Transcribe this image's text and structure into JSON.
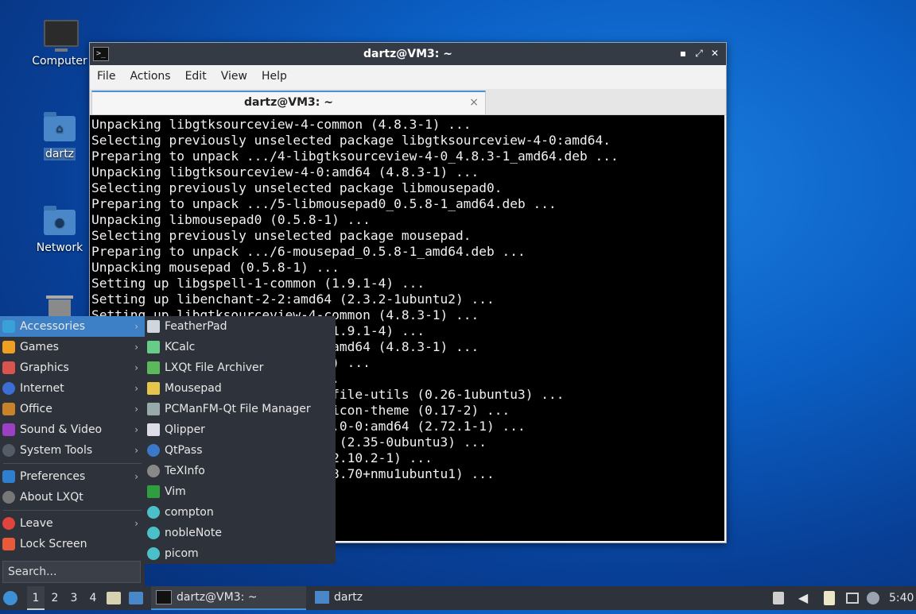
{
  "desktop": {
    "icons": [
      {
        "label": "Computer",
        "icon": "computer-icon"
      },
      {
        "label": "dartz",
        "icon": "home-folder-icon"
      },
      {
        "label": "Network",
        "icon": "network-folder-icon"
      },
      {
        "label": "",
        "icon": "trash-icon"
      }
    ]
  },
  "terminal": {
    "title": "dartz@VM3: ~",
    "menu": [
      "File",
      "Actions",
      "Edit",
      "View",
      "Help"
    ],
    "tab_label": "dartz@VM3: ~",
    "close_glyph": "×",
    "lines": [
      "Unpacking libgtksourceview-4-common (4.8.3-1) ...",
      "Selecting previously unselected package libgtksourceview-4-0:amd64.",
      "Preparing to unpack .../4-libgtksourceview-4-0_4.8.3-1_amd64.deb ...",
      "Unpacking libgtksourceview-4-0:amd64 (4.8.3-1) ...",
      "Selecting previously unselected package libmousepad0.",
      "Preparing to unpack .../5-libmousepad0_0.5.8-1_amd64.deb ...",
      "Unpacking libmousepad0 (0.5.8-1) ...",
      "Selecting previously unselected package mousepad.",
      "Preparing to unpack .../6-mousepad_0.5.8-1_amd64.deb ...",
      "Unpacking mousepad (0.5.8-1) ...",
      "Setting up libgspell-1-common (1.9.1-4) ...",
      "Setting up libenchant-2-2:amd64 (2.3.2-1ubuntu2) ...",
      "Setting up libgtksourceview-4-common (4.8.3-1) ...",
      "                              (1.9.1-4) ...",
      "                              :amd64 (4.8.3-1) ...",
      "                              1) ...",
      "                              ..",
      "                              -file-utils (0.26-1ubuntu3) ...",
      "                              -icon-theme (0.17-2) ...",
      "                              2.0-0:amd64 (2.72.1-1) ...",
      "                              n (2.35-0ubuntu3) ...",
      "                              (2.10.2-1) ...",
      "                              (3.70+nmu1ubuntu1) ..."
    ]
  },
  "start_menu": {
    "categories": [
      {
        "label": "Accessories",
        "icon": "accessories-icon",
        "color": "#3aa0d8"
      },
      {
        "label": "Games",
        "icon": "games-icon",
        "color": "#f0a020"
      },
      {
        "label": "Graphics",
        "icon": "graphics-icon",
        "color": "#d9534f"
      },
      {
        "label": "Internet",
        "icon": "internet-icon",
        "color": "#3b6fd6"
      },
      {
        "label": "Office",
        "icon": "office-icon",
        "color": "#c8832a"
      },
      {
        "label": "Sound & Video",
        "icon": "sound-video-icon",
        "color": "#9b3fc4"
      },
      {
        "label": "System Tools",
        "icon": "system-tools-icon",
        "color": "#555c66"
      },
      {
        "label": "Preferences",
        "icon": "preferences-icon",
        "color": "#2f7fd0"
      },
      {
        "label": "About LXQt",
        "icon": "info-icon",
        "color": "#777"
      },
      {
        "label": "Leave",
        "icon": "power-icon",
        "color": "#e0443c"
      },
      {
        "label": "Lock Screen",
        "icon": "lock-icon",
        "color": "#e85a3a"
      }
    ],
    "arrow": "›",
    "search_placeholder": "Search...",
    "accessories": [
      {
        "label": "FeatherPad",
        "icon": "featherpad-icon",
        "color": "#cfd6de"
      },
      {
        "label": "KCalc",
        "icon": "calculator-icon",
        "color": "#6c8"
      },
      {
        "label": "LXQt File Archiver",
        "icon": "archiver-icon",
        "color": "#5cb85c"
      },
      {
        "label": "Mousepad",
        "icon": "mousepad-icon",
        "color": "#e6c64a"
      },
      {
        "label": "PCManFM-Qt File Manager",
        "icon": "file-manager-icon",
        "color": "#9aa"
      },
      {
        "label": "Qlipper",
        "icon": "clipboard-icon",
        "color": "#dde"
      },
      {
        "label": "QtPass",
        "icon": "qtpass-icon",
        "color": "#3a78c8"
      },
      {
        "label": "TeXInfo",
        "icon": "info-icon",
        "color": "#888"
      },
      {
        "label": "Vim",
        "icon": "vim-icon",
        "color": "#2e9e3e"
      },
      {
        "label": "compton",
        "icon": "gear-icon",
        "color": "#4bc0c8"
      },
      {
        "label": "nobleNote",
        "icon": "note-icon",
        "color": "#4bc0c8"
      },
      {
        "label": "picom",
        "icon": "gear-icon",
        "color": "#4bc0c8"
      }
    ]
  },
  "taskbar": {
    "desktops": [
      "1",
      "2",
      "3",
      "4"
    ],
    "tasks": [
      {
        "label": "dartz@VM3: ~",
        "icon": "terminal-icon"
      },
      {
        "label": "dartz",
        "icon": "folder-icon"
      }
    ],
    "clock": "5:40"
  }
}
